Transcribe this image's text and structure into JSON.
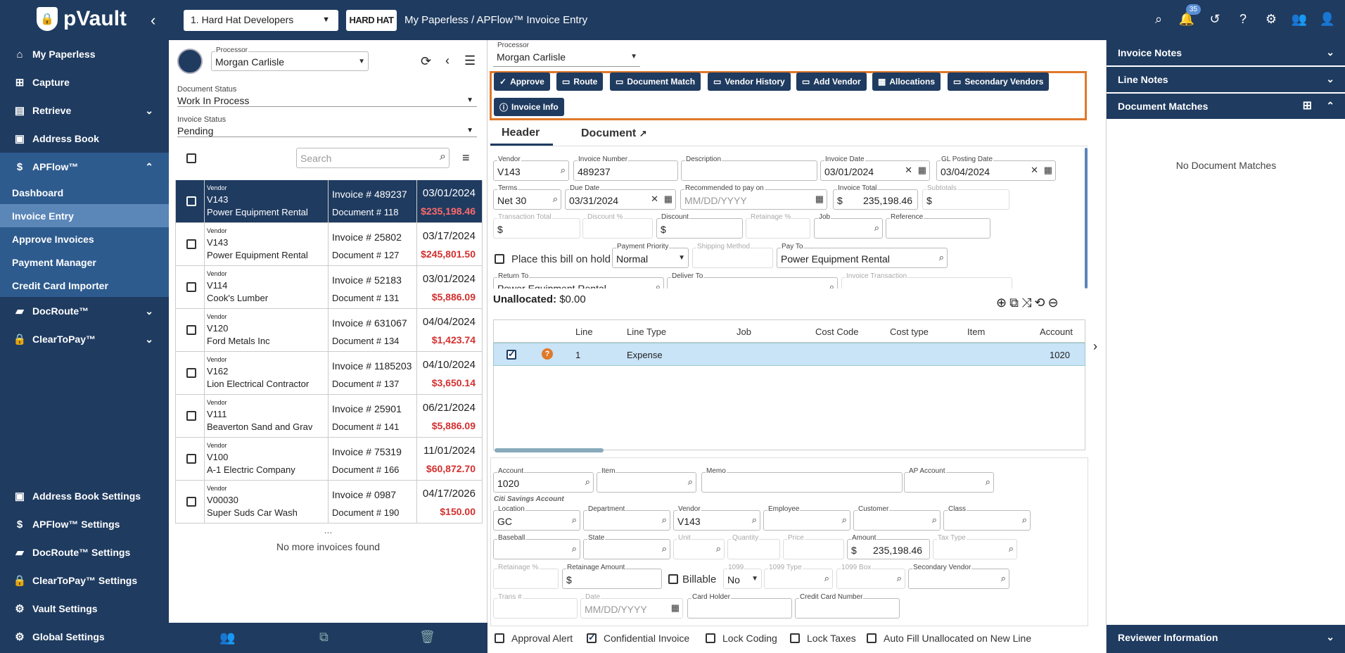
{
  "top": {
    "brand": "pVault",
    "company": "1. Hard Hat Developers",
    "company_logo": "HARD HAT",
    "breadcrumb": "My Paperless  /  APFlow™ Invoice Entry",
    "notification_count": "35"
  },
  "sidebar": {
    "items": [
      {
        "label": "My Paperless",
        "icon": "home-icon"
      },
      {
        "label": "Capture",
        "icon": "capture-icon"
      },
      {
        "label": "Retrieve",
        "icon": "retrieve-icon"
      },
      {
        "label": "Address Book",
        "icon": "address-book-icon"
      },
      {
        "label": "APFlow™",
        "icon": "apflow-icon"
      }
    ],
    "sub": [
      "Dashboard",
      "Invoice Entry",
      "Approve Invoices",
      "Payment Manager",
      "Credit Card Importer"
    ],
    "items2": [
      {
        "label": "DocRoute™"
      },
      {
        "label": "ClearToPay™"
      }
    ],
    "settings": [
      "Address Book Settings",
      "APFlow™ Settings",
      "DocRoute™ Settings",
      "ClearToPay™ Settings",
      "Vault Settings",
      "Global Settings"
    ]
  },
  "list": {
    "processor_label": "Processor",
    "processor": "Morgan Carlisle",
    "doc_status_label": "Document Status",
    "doc_status": "Work In Process",
    "inv_status_label": "Invoice Status",
    "inv_status": "Pending",
    "search_placeholder": "Search",
    "vendor_label": "Vendor",
    "invoice_prefix": "Invoice #",
    "document_prefix": "Document #",
    "rows": [
      {
        "vid": "V143",
        "vname": "Power Equipment Rental",
        "inv": "489237",
        "doc": "118",
        "date": "03/01/2024",
        "amount": "$235,198.46"
      },
      {
        "vid": "V143",
        "vname": "Power Equipment Rental",
        "inv": "25802",
        "doc": "127",
        "date": "03/17/2024",
        "amount": "$245,801.50"
      },
      {
        "vid": "V114",
        "vname": "Cook's Lumber",
        "inv": "52183",
        "doc": "131",
        "date": "03/01/2024",
        "amount": "$5,886.09"
      },
      {
        "vid": "V120",
        "vname": "Ford Metals Inc",
        "inv": "631067",
        "doc": "134",
        "date": "04/04/2024",
        "amount": "$1,423.74"
      },
      {
        "vid": "V162",
        "vname": "Lion Electrical Contractor",
        "inv": "1185203",
        "doc": "137",
        "date": "04/10/2024",
        "amount": "$3,650.14"
      },
      {
        "vid": "V111",
        "vname": "Beaverton Sand and Gravel",
        "inv": "25901",
        "doc": "141",
        "date": "06/21/2024",
        "amount": "$5,886.09"
      },
      {
        "vid": "V100",
        "vname": "A-1 Electric Company",
        "inv": "75319",
        "doc": "166",
        "date": "11/01/2024",
        "amount": "$60,872.70"
      },
      {
        "vid": "V00030",
        "vname": "Super Suds Car Wash",
        "inv": "0987",
        "doc": "190",
        "date": "04/17/2026",
        "amount": "$150.00"
      }
    ],
    "dots": "...",
    "no_more": "No more invoices found"
  },
  "main": {
    "processor_label": "Processor",
    "processor": "Morgan Carlisle",
    "buttons": {
      "approve": "Approve",
      "route": "Route",
      "doc_match": "Document Match",
      "vendor_history": "Vendor History",
      "add_vendor": "Add Vendor",
      "allocations": "Allocations",
      "secondary_vendors": "Secondary Vendors",
      "invoice_info": "Invoice Info"
    },
    "tabs": {
      "header": "Header",
      "document": "Document"
    },
    "h": {
      "vendor_l": "Vendor",
      "vendor": "V143",
      "invnum_l": "Invoice Number",
      "invnum": "489237",
      "desc_l": "Description",
      "invdate_l": "Invoice Date",
      "invdate": "03/01/2024",
      "gl_l": "GL Posting Date",
      "gl": "03/04/2024",
      "terms_l": "Terms",
      "terms": "Net 30",
      "due_l": "Due Date",
      "due": "03/31/2024",
      "rec_l": "Recommended to pay on",
      "rec_ph": "MM/DD/YYYY",
      "total_l": "Invoice Total",
      "total": "235,198.46",
      "sub_l": "Subtotals",
      "trans_l": "Transaction Total",
      "discp_l": "Discount %",
      "disc_l": "Discount",
      "ret_l": "Retainage %",
      "job_l": "Job",
      "ref_l": "Reference",
      "hold": "Place this bill on hold",
      "pp_l": "Payment Priority",
      "pp": "Normal",
      "ship_l": "Shipping Method",
      "payto_l": "Pay To",
      "payto": "Power Equipment Rental",
      "ret_to_l": "Return To",
      "ret_to": "Power Equipment Rental",
      "deliver_l": "Deliver To",
      "invtrans_l": "Invoice Transaction",
      "dollar": "$"
    },
    "unalloc_label": "Unallocated:",
    "unalloc": "$0.00",
    "grid": {
      "cols": [
        "Line",
        "Line Type",
        "Job",
        "Cost Code",
        "Cost type",
        "Item",
        "Account"
      ],
      "row": {
        "line": "1",
        "type": "Expense",
        "account": "1020"
      }
    },
    "d": {
      "account_l": "Account",
      "account": "1020",
      "item_l": "Item",
      "memo_l": "Memo",
      "ap_l": "AP Account",
      "account_name": "Citi Savings Account",
      "loc_l": "Location",
      "loc": "GC",
      "dept_l": "Department",
      "vendor_l": "Vendor",
      "vendor": "V143",
      "emp_l": "Employee",
      "cust_l": "Customer",
      "class_l": "Class",
      "base_l": "Baseball",
      "state_l": "State",
      "unit_l": "Unit",
      "qty_l": "Quantity",
      "price_l": "Price",
      "amount_l": "Amount",
      "amount": "235,198.46",
      "tax_l": "Tax Type",
      "retp_l": "Retainage %",
      "reta_l": "Retainage Amount",
      "billable": "Billable",
      "f1099_l": "1099",
      "f1099": "No",
      "t1099_l": "1099 Type",
      "b1099_l": "1099 Box",
      "sec_l": "Secondary Vendor",
      "trans_l": "Trans #",
      "date_l": "Date",
      "date_ph": "MM/DD/YYYY",
      "holder_l": "Card Holder",
      "ccn_l": "Credit Card Number"
    },
    "bottom": [
      "Approval Alert",
      "Confidential Invoice",
      "Lock Coding",
      "Lock Taxes",
      "Auto Fill Unallocated on New Line"
    ]
  },
  "right": {
    "notes": "Invoice Notes",
    "line_notes": "Line Notes",
    "doc_matches": "Document Matches",
    "no_matches": "No Document Matches",
    "reviewer": "Reviewer Information"
  },
  "colors": {
    "navy": "#1f3b60",
    "accent": "#e0782a",
    "red": "#d32f2f"
  }
}
